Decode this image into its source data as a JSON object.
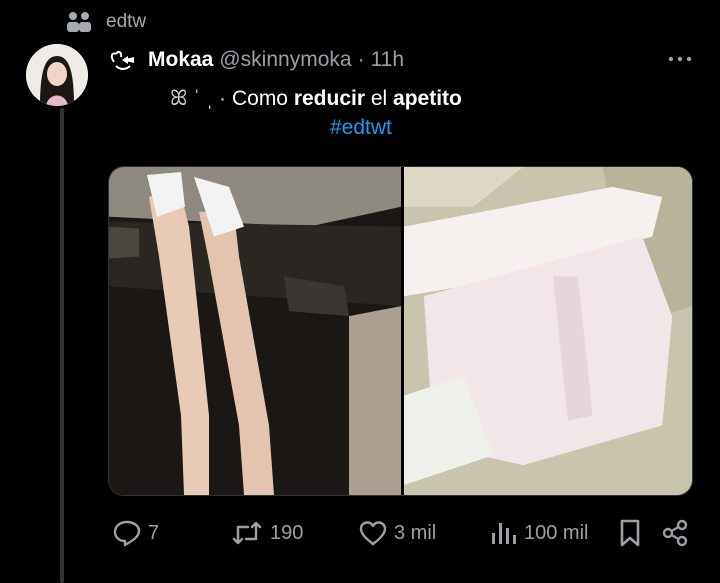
{
  "community": {
    "label": "edtw",
    "icon": "community-icon"
  },
  "post": {
    "avatar": "avatar",
    "badge_icon": "bow-badge-icon",
    "name": "Mokaa",
    "handle": "@skinnymoka",
    "separator": "·",
    "time": "11h",
    "text_deco": "ꕤ ˈ  ˌ ·",
    "text_prefix": "Como ",
    "text_bold1": "reducir",
    "text_mid": " el ",
    "text_bold2": "apetito",
    "hashtag": "#edtwt"
  },
  "media": {
    "images": [
      "photo-legs-in-car",
      "photo-white-outfit"
    ]
  },
  "actions": {
    "replies": "7",
    "reposts": "190",
    "likes": "3 mil",
    "views": "100 mil"
  },
  "colors": {
    "background": "#000000",
    "text": "#e7e9ea",
    "muted": "#9aa0a6",
    "link": "#1d9bf0"
  }
}
